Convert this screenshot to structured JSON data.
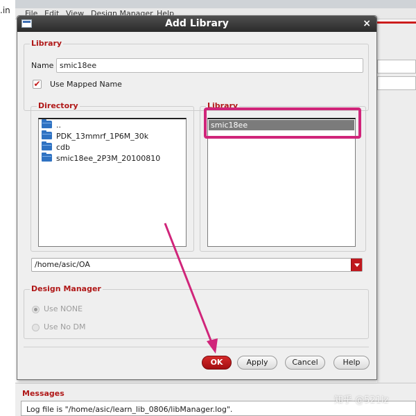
{
  "background": {
    "left_text": ".in",
    "menu": [
      "File",
      "Edit",
      "View",
      "Design Manager",
      "Help"
    ],
    "messages_title": "Messages",
    "log_text": "Log file is \"/home/asic/learn_lib_0806/libManager.log\".",
    "watermark": "知乎 @521lz"
  },
  "dialog": {
    "title": "Add Library",
    "close_glyph": "×",
    "library_group": {
      "label": "Library",
      "name_label": "Name",
      "name_value": "smic18ee",
      "use_mapped_label": "Use Mapped Name",
      "use_mapped_checked": true,
      "check_glyph": "✔"
    },
    "directory": {
      "label": "Directory",
      "items": [
        {
          "name": "..",
          "icon": "folder-icon"
        },
        {
          "name": "PDK_13mmrf_1P6M_30k",
          "icon": "folder-icon"
        },
        {
          "name": "cdb",
          "icon": "folder-icon"
        },
        {
          "name": "smic18ee_2P3M_20100810",
          "icon": "folder-icon"
        }
      ]
    },
    "library_list": {
      "label": "Library",
      "items": [
        "smic18ee"
      ],
      "selected_index": 0
    },
    "path": "/home/asic/OA",
    "design_manager": {
      "label": "Design Manager",
      "options": [
        "Use  NONE",
        "Use No DM"
      ],
      "selected_index": 0
    },
    "buttons": {
      "ok": "OK",
      "apply": "Apply",
      "cancel": "Cancel",
      "help": "Help"
    }
  },
  "colors": {
    "accent_red": "#c0181e",
    "annotation_magenta": "#d0257a",
    "title_bar": "#2a2a2a"
  }
}
